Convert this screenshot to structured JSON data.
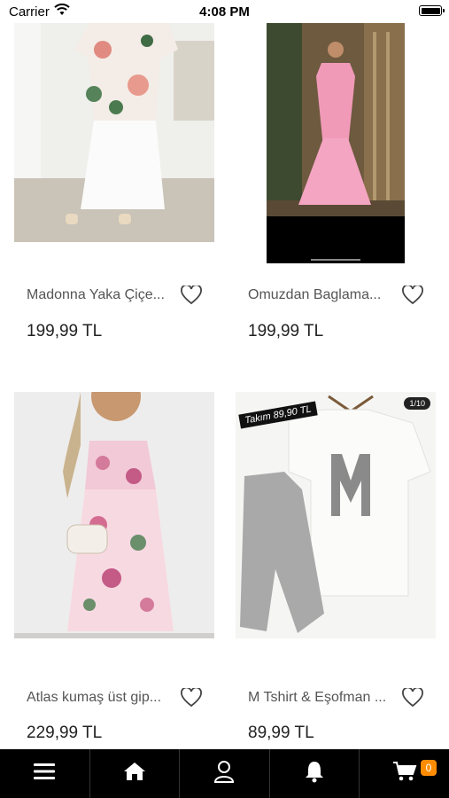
{
  "status": {
    "carrier": "Carrier",
    "time": "4:08 PM"
  },
  "products": [
    {
      "name": "Madonna Yaka Çiçe...",
      "price": "199,99 TL",
      "image": "floral-wrap-dress-photo"
    },
    {
      "name": "Omuzdan Baglama...",
      "price": "199,99 TL",
      "image": "pink-maxi-dress-photo"
    },
    {
      "name": "Atlas kumaş üst gip...",
      "price": "229,99 TL",
      "image": "floral-midi-dress-photo"
    },
    {
      "name": "M Tshirt & Eşofman ...",
      "price": "89,99 TL",
      "image": "tshirt-jogger-set-photo",
      "tag": "Takım 89,90 TL",
      "counter": "1/10"
    }
  ],
  "tabbar": {
    "items": [
      "menu-icon",
      "home-icon",
      "profile-icon",
      "notification-icon",
      "cart-icon"
    ],
    "cart_count": "0"
  },
  "colors": {
    "tabbar_bg": "#000000",
    "badge": "#ff8c00"
  }
}
